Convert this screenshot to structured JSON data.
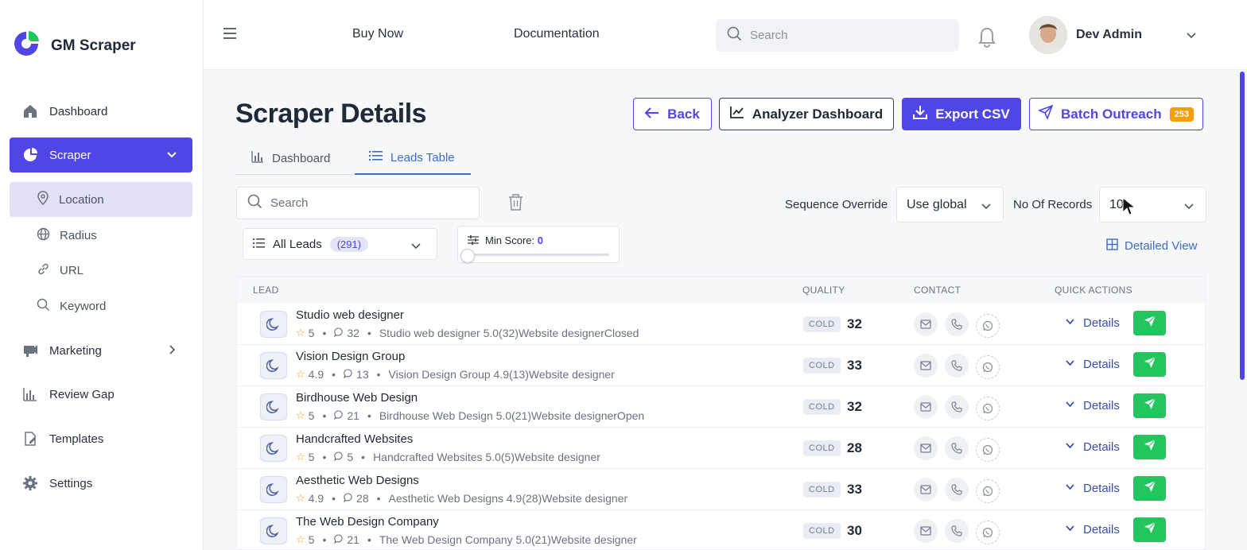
{
  "brand": {
    "name": "GM Scraper"
  },
  "sidebar": {
    "items": [
      {
        "label": "Dashboard",
        "icon": "home-icon"
      },
      {
        "label": "Scraper",
        "icon": "pie-chart-icon",
        "active": true
      },
      {
        "label": "Marketing",
        "icon": "megaphone-icon"
      },
      {
        "label": "Review Gap",
        "icon": "bar-chart-icon"
      },
      {
        "label": "Templates",
        "icon": "file-edit-icon"
      },
      {
        "label": "Settings",
        "icon": "gear-icon"
      }
    ],
    "subitems": [
      {
        "label": "Location",
        "icon": "map-pin-icon",
        "active": true
      },
      {
        "label": "Radius",
        "icon": "globe-icon"
      },
      {
        "label": "URL",
        "icon": "link-icon"
      },
      {
        "label": "Keyword",
        "icon": "search-icon"
      }
    ]
  },
  "header": {
    "links": [
      "Buy Now",
      "Documentation"
    ],
    "search_placeholder": "Search",
    "user_name": "Dev Admin"
  },
  "page": {
    "title": "Scraper Details",
    "buttons": {
      "back": "Back",
      "analyzer": "Analyzer Dashboard",
      "export": "Export CSV",
      "batch": "Batch Outreach",
      "batch_count": "253"
    },
    "tabs": [
      "Dashboard",
      "Leads Table"
    ],
    "active_tab": "Leads Table",
    "lead_search_placeholder": "Search",
    "sequence_label": "Sequence Override",
    "sequence_value": "Use global",
    "records_label": "No Of Records",
    "records_value": "10",
    "filter_label": "All Leads",
    "filter_count": "(291)",
    "min_score_label": "Min Score:",
    "min_score_value": "0",
    "min_score_fraction": 0,
    "detailed_view": "Detailed View"
  },
  "table": {
    "columns": [
      "LEAD",
      "QUALITY",
      "CONTACT",
      "QUICK ACTIONS"
    ],
    "rows": [
      {
        "name": "Studio web designer",
        "rating": "5",
        "reviews": "32",
        "desc": "Studio web designer 5.0(32)Website designerClosed",
        "quality": "COLD",
        "score": "32",
        "action": "Details"
      },
      {
        "name": "Vision Design Group",
        "rating": "4.9",
        "reviews": "13",
        "desc": "Vision Design Group 4.9(13)Website designer",
        "quality": "COLD",
        "score": "33",
        "action": "Details"
      },
      {
        "name": "Birdhouse Web Design",
        "rating": "5",
        "reviews": "21",
        "desc": "Birdhouse Web Design 5.0(21)Website designerOpen",
        "quality": "COLD",
        "score": "32",
        "action": "Details"
      },
      {
        "name": "Handcrafted Websites",
        "rating": "5",
        "reviews": "5",
        "desc": "Handcrafted Websites 5.0(5)Website designer",
        "quality": "COLD",
        "score": "28",
        "action": "Details"
      },
      {
        "name": "Aesthetic Web Designs",
        "rating": "4.9",
        "reviews": "28",
        "desc": "Aesthetic Web Designs 4.9(28)Website designer",
        "quality": "COLD",
        "score": "33",
        "action": "Details"
      },
      {
        "name": "The Web Design Company",
        "rating": "5",
        "reviews": "21",
        "desc": "The Web Design Company 5.0(21)Website designer",
        "quality": "COLD",
        "score": "30",
        "action": "Details"
      }
    ]
  },
  "colors": {
    "accent": "#4f46e5",
    "send": "#22c55e",
    "badge": "#f59e0b",
    "link": "#3b6cc7"
  }
}
